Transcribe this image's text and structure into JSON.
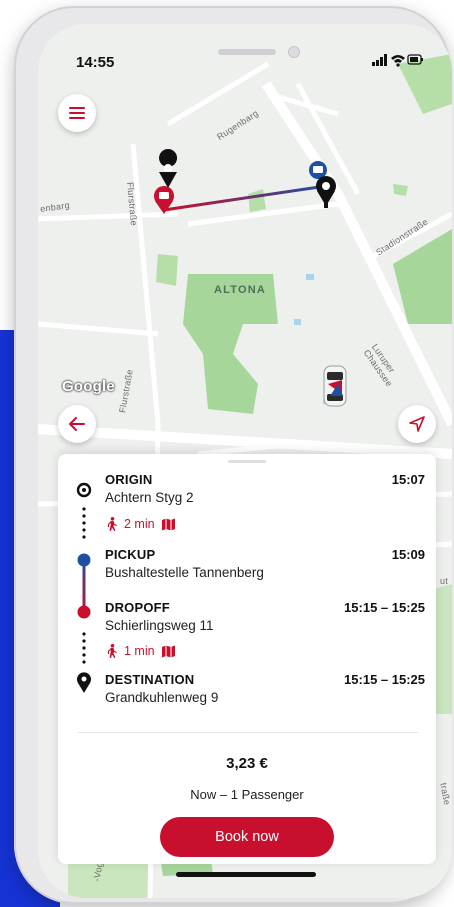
{
  "status_bar": {
    "time": "14:55"
  },
  "map": {
    "area_label": "ALTONA",
    "street_labels": [
      "Rugenbarg",
      "Flurstraße",
      "Stadionstraße",
      "Luruper Chaussee",
      "Flurstraße",
      "-Vogh"
    ],
    "street_fragments": [
      "enbarg",
      "ut",
      "traße"
    ],
    "attribution": "Google"
  },
  "route": {
    "stops": [
      {
        "label": "ORIGIN",
        "address": "Achtern Styg 2",
        "time": "15:07"
      },
      {
        "label": "PICKUP",
        "address": "Bushaltestelle Tannenberg",
        "time": "15:09"
      },
      {
        "label": "DROPOFF",
        "address": "Schierlingsweg 11",
        "time": "15:15 – 15:25"
      },
      {
        "label": "DESTINATION",
        "address": "Grandkuhlenweg 9",
        "time": "15:15 – 15:25"
      }
    ],
    "walks": [
      {
        "duration": "2 min"
      },
      {
        "duration": "1 min"
      }
    ]
  },
  "booking": {
    "price": "3,23 €",
    "passengers": "Now – 1 Passenger",
    "book_label": "Book now"
  },
  "colors": {
    "accent": "#c8102e",
    "pickup": "#1e4fa3",
    "park": "#a6d69a"
  }
}
